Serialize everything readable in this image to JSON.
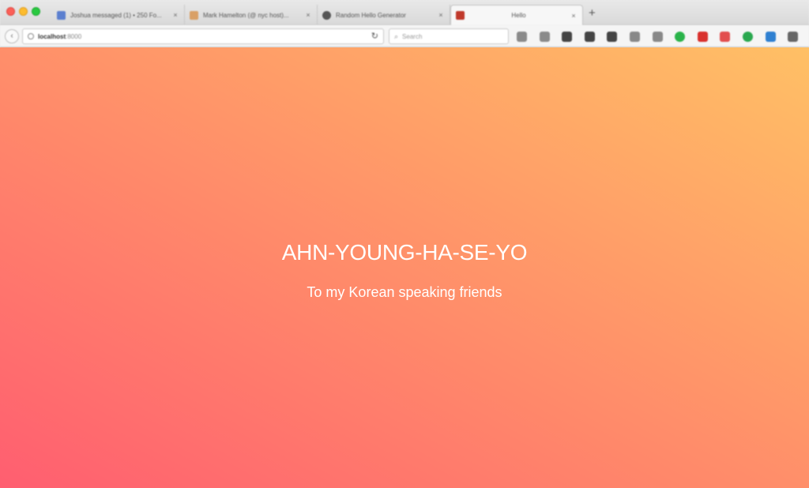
{
  "tabs": [
    {
      "label": "Joshua messaged (1) • 250 Fo...",
      "close": "×",
      "favicon_color": "#5b7fcf",
      "active": false
    },
    {
      "label": "Mark Hamelton (@ nyc host)...",
      "close": "×",
      "favicon_color": "#d9a066",
      "active": false
    },
    {
      "label": "Random Hello Generator",
      "close": "×",
      "favicon_color": "#555555",
      "active": false
    },
    {
      "label": "Hello",
      "close": "×",
      "favicon_color": "#c0392b",
      "active": true
    }
  ],
  "new_tab_label": "+",
  "navbar": {
    "back_label": "‹",
    "url_host": "localhost",
    "url_port": ":8000",
    "reload_label": "↻",
    "search_placeholder": "Search",
    "search_icon": "🔍",
    "extensions": [
      {
        "name": "ext-icon-1",
        "color": "#8a8a8a"
      },
      {
        "name": "ext-icon-2",
        "color": "#8a8a8a"
      },
      {
        "name": "ext-icon-3",
        "color": "#444444"
      },
      {
        "name": "ext-icon-4",
        "color": "#444444"
      },
      {
        "name": "ext-icon-5",
        "color": "#444444"
      },
      {
        "name": "ext-icon-6",
        "color": "#888888"
      },
      {
        "name": "ext-icon-7",
        "color": "#888888"
      },
      {
        "name": "ext-icon-8",
        "color": "#2ab34a"
      },
      {
        "name": "ext-icon-9",
        "color": "#d9302c"
      },
      {
        "name": "ext-icon-10",
        "color": "#e24e4e"
      },
      {
        "name": "ext-icon-11",
        "color": "#2aa84f"
      },
      {
        "name": "ext-icon-12",
        "color": "#2f80d1"
      },
      {
        "name": "ext-icon-13",
        "color": "#666666"
      }
    ]
  },
  "page": {
    "heading": "AHN-YOUNG-HA-SE-YO",
    "subheading": "To my Korean speaking friends",
    "gradient_start": "#ff5e70",
    "gradient_end": "#ffc065"
  }
}
